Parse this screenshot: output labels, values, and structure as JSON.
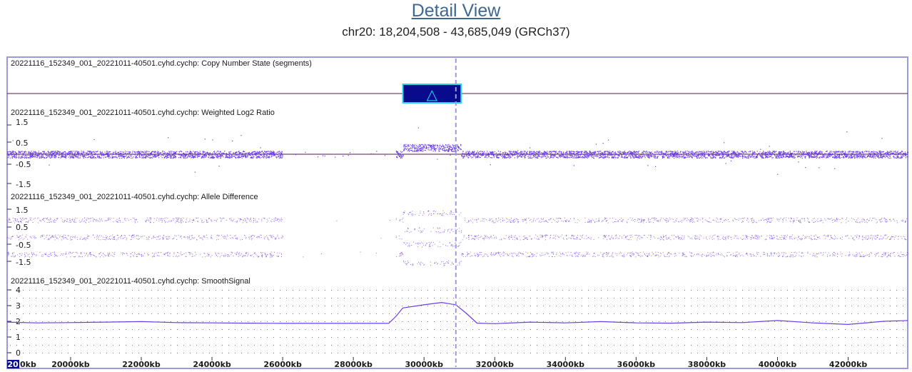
{
  "page": {
    "title": "Detail View",
    "region": "chr20: 18,204,508 - 43,685,049 (GRCh37)"
  },
  "colors": {
    "frame": "#9b9bdc",
    "signal": "#6a3de8",
    "segment_fill": "#0a0a8c",
    "segment_border": "#29d3f0",
    "cursor": "#9b9bdc",
    "chromosome_badge": "#0a0a8c"
  },
  "chromosome_badge": "20",
  "tracks": {
    "cn_state": {
      "label": "20221116_152349_001_20221011-40501.cyhd.cychp: Copy Number State (segments)",
      "segment_symbol": "△",
      "segment": {
        "start_kb": 29400,
        "end_kb": 31050,
        "type": "gain"
      }
    },
    "log2": {
      "label": "20221116_152349_001_20221011-40501.cyhd.cychp: Weighted Log2 Ratio",
      "ticks": [
        "1.5",
        "0.5",
        "-0.5",
        "-1.5"
      ]
    },
    "allele": {
      "label": "20221116_152349_001_20221011-40501.cyhd.cychp: Allele Difference",
      "ticks": [
        "1.5",
        "0.5",
        "-0.5",
        "-1.5"
      ]
    },
    "smooth": {
      "label": "20221116_152349_001_20221011-40501.cyhd.cychp: SmoothSignal",
      "ticks": [
        "4",
        "3",
        "2",
        "1",
        "0"
      ]
    }
  },
  "cursor_kb": 30900,
  "chart_data": {
    "type": "line",
    "title": "",
    "xlabel": "",
    "ylabel": "",
    "x_ticks_kb": [
      20000,
      22000,
      24000,
      26000,
      28000,
      30000,
      32000,
      34000,
      36000,
      38000,
      40000,
      42000
    ],
    "x_tick_labels": [
      "20000kb",
      "22000kb",
      "24000kb",
      "26000kb",
      "28000kb",
      "30000kb",
      "32000kb",
      "34000kb",
      "36000kb",
      "38000kb",
      "40000kb",
      "42000kb"
    ],
    "first_tick_suffix": "0kb",
    "xlim_kb": [
      18204,
      43685
    ],
    "series": [
      {
        "x": [
          18204,
          19000,
          20000,
          21000,
          22000,
          23000,
          24000,
          25000,
          26000,
          27000,
          28000,
          29000,
          29200,
          29400,
          30000,
          30500,
          30900,
          31200,
          31500,
          32000,
          33000,
          34000,
          35000,
          36000,
          37000,
          38000,
          39000,
          40000,
          41000,
          42000,
          43000,
          43685
        ],
        "values": [
          1.95,
          1.9,
          1.92,
          1.95,
          1.98,
          1.92,
          1.9,
          1.88,
          1.87,
          1.87,
          1.87,
          1.87,
          2.3,
          2.85,
          3.05,
          3.2,
          3.05,
          2.5,
          1.88,
          1.85,
          1.95,
          1.9,
          1.98,
          1.9,
          1.88,
          1.95,
          1.92,
          2.05,
          1.9,
          1.8,
          2.0,
          2.05
        ]
      }
    ],
    "ylim": [
      0,
      4
    ]
  }
}
